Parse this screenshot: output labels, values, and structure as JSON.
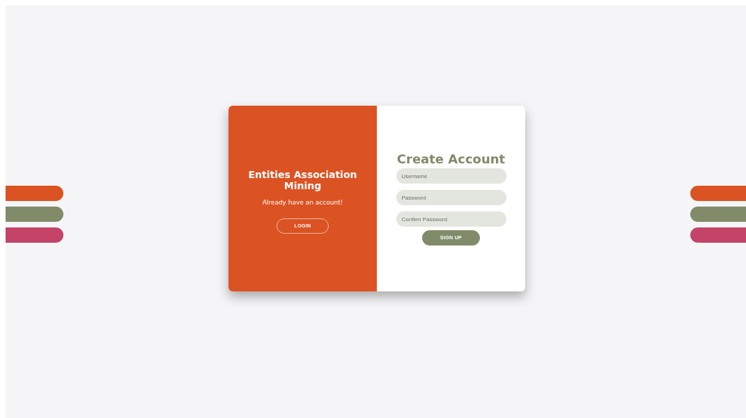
{
  "left_bars": [
    {
      "color": "#db5323"
    },
    {
      "color": "#818b69"
    },
    {
      "color": "#c44368"
    }
  ],
  "right_bars": [
    {
      "color": "#db5323"
    },
    {
      "color": "#818b69"
    },
    {
      "color": "#c44368"
    }
  ],
  "overlay": {
    "title": "Entities Association Mining",
    "text": "Already have an account!",
    "button": "LOGIN"
  },
  "form": {
    "title": "Create Account",
    "fields": [
      {
        "placeholder": "Username"
      },
      {
        "placeholder": "Password"
      },
      {
        "placeholder": "Confirm Password"
      }
    ],
    "button": "SIGN UP"
  }
}
